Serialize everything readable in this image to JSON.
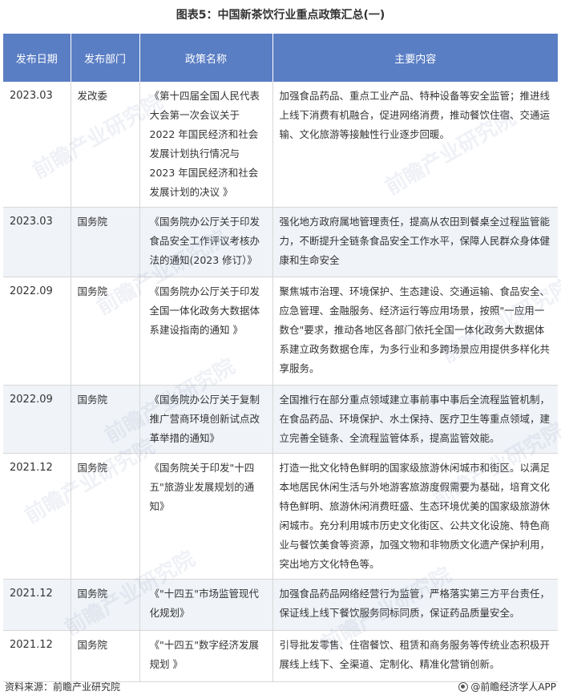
{
  "title": "图表5：中国新茶饮行业重点政策汇总(一)",
  "columns": [
    "发布日期",
    "发布部门",
    "政策名称",
    "主要内容"
  ],
  "rows": [
    {
      "date": "2023.03",
      "dept": "发改委",
      "name": "《第十四届全国人民代表大会第一次会议关于 2022 年国民经济和社会发展计划执行情况与 2023 年国民经济和社会发展计划的决议 》",
      "content": "加强食品药品、重点工业产品、特种设备等安全监管；推进线上线下消费有机融合，促进网络消费，推动餐饮住宿、交通运输、文化旅游等接触性行业逐步回暖。"
    },
    {
      "date": "2023.03",
      "dept": "国务院",
      "name": "《国务院办公厅关于印发食品安全工作评议考核办法的通知(2023 修订）》",
      "content": "强化地方政府属地管理责任，提高从农田到餐桌全过程监管能力，不断提升全链条食品安全工作水平，保障人民群众身体健康和生命安全"
    },
    {
      "date": "2022.09",
      "dept": "国务院",
      "name": "《国务院办公厅关于印发全国一体化政务大数据体系建设指南的通知 》",
      "content": "聚焦城市治理、环境保护、生态建设、交通运输、食品安全、应急管理、金融服务、经济运行等应用场景，按照\"一应用一数仓\"要求，推动各地区各部门依托全国一体化政务大数据体系建立政务数据仓库，为多行业和多跨场景应用提供多样化共享服务。"
    },
    {
      "date": "2022.09",
      "dept": "国务院",
      "name": "《国务院办公厅关于复制推广营商环境创新试点改革举措的通知》",
      "content": "全国推行在部分重点领域建立事前事中事后全流程监管机制，在食品药品、环境保护、水土保持、医疗卫生等重点领域，建立完善全链条、全流程监管体系，提高监管效能。"
    },
    {
      "date": "2021.12",
      "dept": "国务院",
      "name": "《国务院关于印发\"十四五\"旅游业发展规划的通知》",
      "content": "打造一批文化特色鲜明的国家级旅游休闲城市和街区。以满足本地居民休闲生活与外地游客旅游度假需要为基础，培育文化特色鲜明、旅游休闲消费旺盛、生态环境优美的国家级旅游休闲城市。充分利用城市历史文化街区、公共文化设施、特色商业与餐饮美食等资源，加强文物和非物质文化遗产保护利用，突出地方文化特色等。"
    },
    {
      "date": "2021.12",
      "dept": "国务院",
      "name": "《\"十四五\"市场监管现代化规划》",
      "content": "加强食品药品网络经营行为监管，严格落实第三方平台责任，保证线上线下餐饮服务同标同质，保证药品质量安全。"
    },
    {
      "date": "2021.12",
      "dept": "国务院",
      "name": "《\"十四五\"数字经济发展规划 》",
      "content": "引导批发零售、住宿餐饮、租赁和商务服务等传统业态积极开展线上线下、全渠道、定制化、精准化营销创新。"
    }
  ],
  "footer": {
    "source": "资料来源：前瞻产业研究院",
    "brand": "@前瞻经济学人APP"
  },
  "watermark": "前瞻产业研究院",
  "colors": {
    "header_bg": "#5a7ec4",
    "row_alt_bg": "#f0f3f8"
  }
}
